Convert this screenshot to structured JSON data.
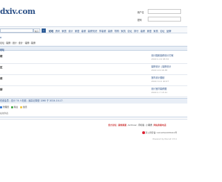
{
  "header": {
    "logo_text": "dxiv.com",
    "logo_subtitle": "",
    "login": {
      "username_label": "用户名",
      "password_label": "密码"
    }
  },
  "nav": {
    "search_placeholder": "",
    "search_scope": "帖子",
    "search_button_icon": "search-icon",
    "items": [
      "论坛",
      "资讯",
      "家居",
      "设计",
      "家居",
      "装修",
      "装修知识",
      "学装修",
      "装修",
      "导购",
      "家具",
      "论坛",
      "排行",
      "装修",
      "家居",
      "家具",
      "论坛",
      "品牌"
    ]
  },
  "breadcrumb": {
    "home_icon": "home-icon",
    "crumbs": [
      "论坛",
      "装修",
      "设计",
      "设计 · 装修",
      "装修"
    ]
  },
  "forum": {
    "header_label": "论坛",
    "rows": [
      {
        "name": "楼",
        "stats": "",
        "last_title": "设计图纸装修设计方案",
        "last_date": "2022-1-19 18:34"
      },
      {
        "name": "区",
        "stats": "",
        "last_title": "装修设计 | 装修设计",
        "last_date": "2022-9-6 16:38"
      },
      {
        "name": "装",
        "stats": "",
        "last_title": "室内设计图纸",
        "last_date": "2022-3-11 10:07"
      },
      {
        "name": "厨",
        "stats": "",
        "last_title": "设计室内装修图",
        "last_date": "2022-1-7 13:41"
      }
    ]
  },
  "online": {
    "title": "在线会员 - 总计 74 人在线 - 最高记录是 1260 于 2024-10-17.",
    "legend": [
      {
        "label": "管理员",
        "color": "#3a7bd5"
      },
      {
        "label": "版主",
        "color": "#4caf50"
      },
      {
        "label": "会员",
        "color": "#f2c94c"
      }
    ],
    "link": "在线列表"
  },
  "footer": {
    "links": [
      "官方论坛",
      "装修频道",
      "Archiver",
      "手机版",
      "小黑屋",
      "网站举报电话"
    ],
    "gov_text": "京公网安备 11010502035001号",
    "copyright": "Powered by Discuz! X3.4"
  },
  "colors": {
    "brand_blue": "#2a4f86",
    "header_bar": "#e8eef6",
    "search_button": "#2a5a96"
  }
}
